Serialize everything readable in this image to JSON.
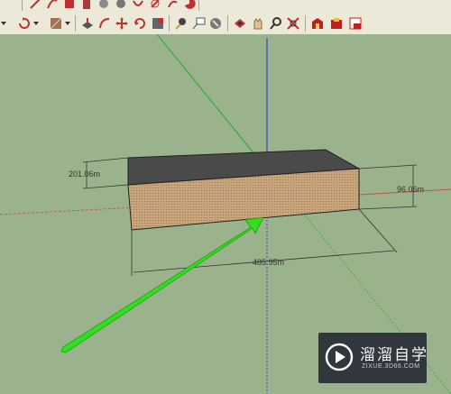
{
  "toolbar_top": {
    "icons": [
      "pencil-icon",
      "arc-icon",
      "rectangle-icon",
      "eraser-icon",
      "circle-icon",
      "polygon-icon",
      "freehand-icon",
      "tape-icon",
      "rotated-rect-icon",
      "pie-icon"
    ]
  },
  "toolbar_main": {
    "icons": [
      "rotate-icon",
      "paint-bucket-icon",
      "push-pull-icon",
      "follow-me-icon",
      "move-icon",
      "rotate-tool-icon",
      "scale-icon",
      "tape-measure-icon",
      "text-label-icon",
      "3d-text-icon",
      "orbit-icon",
      "pan-icon",
      "zoom-icon",
      "zoom-extents-icon",
      "warehouse-icon",
      "extension-warehouse-icon",
      "layout-icon"
    ]
  },
  "model": {
    "box_top_color": "#4a4a4a",
    "box_front_color": "#c8a57a",
    "box_side_color": "#bfa07a",
    "dimensions": {
      "depth_label": "201.06m",
      "height_label": "96.06m",
      "length_label": "485.95m"
    }
  },
  "axes": {
    "red": "#c0504d",
    "green": "#2faa2f",
    "blue": "#2a2ad0"
  },
  "annotation": {
    "arrow_color": "#33dd22"
  },
  "watermark": {
    "brand_text": "溜溜自学",
    "url_text": "ZIXUE.3D66.COM"
  }
}
